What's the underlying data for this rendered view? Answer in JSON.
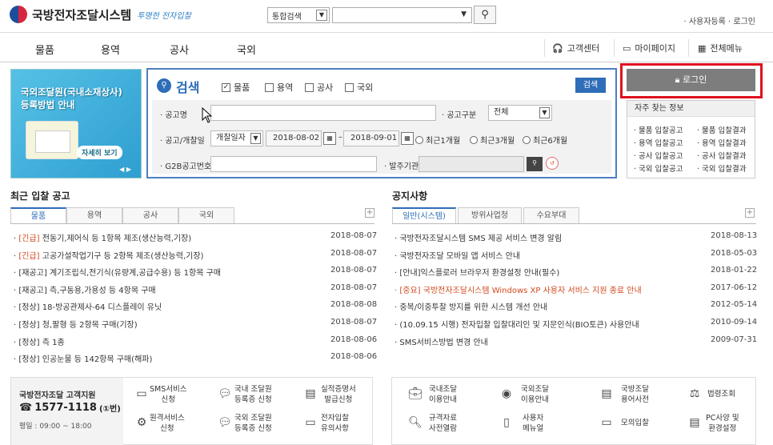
{
  "header": {
    "logo_title": "국방전자조달시스템",
    "logo_slogan": "투명한 전자입찰",
    "search_select": "통합검색",
    "search_icon": "magnifier",
    "links": "· 사용자등록  · 로그인"
  },
  "nav": {
    "items": [
      "물품",
      "용역",
      "공사",
      "국외"
    ],
    "util": [
      "고객센터",
      "마이페이지",
      "전체메뉴"
    ]
  },
  "banner": {
    "title_line1": "국외조달원(국내소재상사)",
    "title_line2": "등록방법 안내",
    "more": "자세히 보기",
    "pager": "◀ ▶"
  },
  "search": {
    "title": "검색",
    "types": [
      "물품",
      "용역",
      "공사",
      "국외"
    ],
    "button": "검색",
    "notice_label": "· 공고명",
    "category_label": "· 공고구분",
    "category_value": "전체",
    "date_label": "· 공고/개찰일",
    "date_type": "개찰일자",
    "date_from": "2018-08-02",
    "date_to": "2018-09-01",
    "ranges": [
      "최근1개월",
      "최근3개월",
      "최근6개월"
    ],
    "g2b_label": "· G2B공고번호",
    "agency_label": "· 발주기관"
  },
  "login": {
    "button": "로그인"
  },
  "faq": {
    "title": "자주 찾는 정보",
    "items": [
      "· 물품 입찰공고",
      "· 물품 입찰결과",
      "· 용역 입찰공고",
      "· 용역 입찰결과",
      "· 공사 입찰공고",
      "· 공사 입찰결과",
      "· 국외 입찰공고",
      "· 국외 입찰결과"
    ]
  },
  "recent": {
    "title": "최근 입찰 공고",
    "tabs": [
      "물품",
      "용역",
      "공사",
      "국외"
    ],
    "rows": [
      {
        "tag": "[긴급]",
        "text": " 전동기,제어식 등 1항목 제조(생산능력,기장)",
        "date": "2018-08-07"
      },
      {
        "tag": "[긴급]",
        "text": " 고공가설작업기구 등 2항목 제조(생산능력,기장)",
        "date": "2018-08-07"
      },
      {
        "tag": "",
        "text": "[재공고] 계기조립식,전기식(유량계,공급수용) 등 1항목 구매",
        "date": "2018-08-07"
      },
      {
        "tag": "",
        "text": "[재공고] 측,구동용,가용성 등 4항목 구매",
        "date": "2018-08-07"
      },
      {
        "tag": "",
        "text": "[정상] 18-방공관제사-64 디스플레이 유닛",
        "date": "2018-08-08"
      },
      {
        "tag": "",
        "text": "[정상] 청,팔형 등 2항목 구매(기장)",
        "date": "2018-08-07"
      },
      {
        "tag": "",
        "text": "[정상] 측 1종",
        "date": "2018-08-06"
      },
      {
        "tag": "",
        "text": "[정상] 인공눈물 등 142항목 구매(해파)",
        "date": "2018-08-06"
      }
    ]
  },
  "notice": {
    "title": "공지사항",
    "tabs": [
      "일반(시스템)",
      "방위사업청",
      "수요부대"
    ],
    "rows": [
      {
        "text": "국방전자조달시스템 SMS 제공 서비스 변경 알림",
        "date": "2018-08-13",
        "hl": false
      },
      {
        "text": "국방전자조달 모바일 앱 서비스 안내",
        "date": "2018-05-03",
        "hl": false
      },
      {
        "text": "[안내]익스플로러 브라우저 환경설정 안내(필수)",
        "date": "2018-01-22",
        "hl": false
      },
      {
        "text": "[중요] 국방전자조달시스템 Windows XP 사용자 서비스 지원 종료 안내",
        "date": "2017-06-12",
        "hl": true
      },
      {
        "text": "중복/이중투찰 방지를 위한 시스템 개선 안내",
        "date": "2012-05-14",
        "hl": false
      },
      {
        "text": "(10.09.15 시행) 전자입찰 입찰대리인 및 지문인식(BIO토큰) 사용안내",
        "date": "2010-09-14",
        "hl": false
      },
      {
        "text": "SMS서비스방법 변경 안내",
        "date": "2009-07-31",
        "hl": false
      }
    ]
  },
  "customer": {
    "title": "국방전자조달 고객지원",
    "phone": "1577-1118",
    "phone_suffix": "(①번)",
    "hours": "평일 : 09:00 ~ 18:00"
  },
  "services_left": [
    {
      "l1": "SMS서비스",
      "l2": "신청"
    },
    {
      "l1": "국내 조달원",
      "l2": "등록증 신청"
    },
    {
      "l1": "실적증명서",
      "l2": "발급신청"
    },
    {
      "l1": "원격서비스",
      "l2": "신청"
    },
    {
      "l1": "국외 조달원",
      "l2": "등록증 신청"
    },
    {
      "l1": "전자입찰",
      "l2": "유의사항"
    }
  ],
  "services_right": [
    {
      "l1": "국내조달",
      "l2": "이용안내"
    },
    {
      "l1": "국외조달",
      "l2": "이용안내"
    },
    {
      "l1": "국방조달",
      "l2": "용어사전"
    },
    {
      "l1": "법령조회",
      "l2": ""
    },
    {
      "l1": "규격자료",
      "l2": "사전열람"
    },
    {
      "l1": "사용자",
      "l2": "메뉴얼"
    },
    {
      "l1": "모의입찰",
      "l2": ""
    },
    {
      "l1": "PC사양 및",
      "l2": "환경설정"
    }
  ]
}
